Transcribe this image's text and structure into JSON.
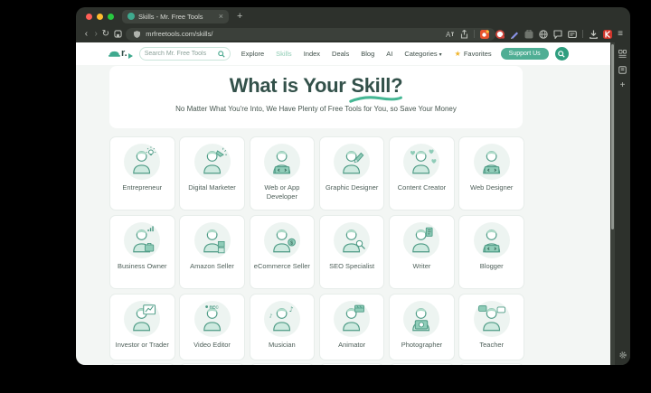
{
  "browser": {
    "tab_title": "Skills - Mr. Free Tools",
    "tab_close_glyph": "×",
    "new_tab_glyph": "+",
    "url": "mrfreetools.com/skills/",
    "traffic_lights": [
      {
        "name": "close-window-button",
        "color": "#ff5f57"
      },
      {
        "name": "minimize-window-button",
        "color": "#febc2e"
      },
      {
        "name": "zoom-window-button",
        "color": "#28c840"
      }
    ],
    "toolbar_icons": [
      "back-icon",
      "forward-icon",
      "reload-icon",
      "bookmark-icon",
      "shield-icon"
    ],
    "url_action_icons": [
      "translate-icon",
      "share-icon",
      "extension-main-icon"
    ],
    "pinned_extensions": [
      {
        "name": "extension-red-circle-icon",
        "style": "red-circle"
      },
      {
        "name": "extension-pen-icon",
        "style": "pen"
      },
      {
        "name": "extension-dark-square-icon",
        "style": "dark-square"
      },
      {
        "name": "extension-globe-icon",
        "style": "globe"
      },
      {
        "name": "extension-chat-icon",
        "style": "chat"
      },
      {
        "name": "extension-card-icon",
        "style": "card"
      }
    ],
    "right_icons": [
      "download-icon",
      "red-k-extension-icon",
      "menu-icon"
    ],
    "sidebar_icons": [
      "tab-groups-icon",
      "panel-icon",
      "add-tab-icon",
      "settings-gear-icon"
    ]
  },
  "navbar": {
    "logo_text": "r.",
    "search_placeholder": "Search Mr. Free Tools",
    "links": [
      {
        "label": "Explore",
        "active": false
      },
      {
        "label": "Skills",
        "active": true
      },
      {
        "label": "Index",
        "active": false
      },
      {
        "label": "Deals",
        "active": false
      },
      {
        "label": "Blog",
        "active": false
      },
      {
        "label": "AI",
        "active": false
      },
      {
        "label": "Categories",
        "active": false,
        "has_dropdown": true
      }
    ],
    "favorites_label": "Favorites",
    "support_label": "Support Us"
  },
  "hero": {
    "title_prefix": "What is Your ",
    "title_highlight": "Skill?",
    "subtitle": "No Matter What You're Into, We Have Plenty of Free Tools for You, so Save Your Money"
  },
  "skills": [
    {
      "label": "Entrepreneur",
      "icon": "entrepreneur-icon",
      "accessory": "bulb"
    },
    {
      "label": "Digital Marketer",
      "icon": "digital-marketer-icon",
      "accessory": "megaphone"
    },
    {
      "label": "Web or App Developer",
      "icon": "web-or-app-developer-icon",
      "accessory": "laptop"
    },
    {
      "label": "Graphic Designer",
      "icon": "graphic-designer-icon",
      "accessory": "pen"
    },
    {
      "label": "Content Creator",
      "icon": "content-creator-icon",
      "accessory": "hearts"
    },
    {
      "label": "Web Designer",
      "icon": "web-designer-icon",
      "accessory": "laptop"
    },
    {
      "label": "Business Owner",
      "icon": "business-owner-icon",
      "accessory": "briefcase"
    },
    {
      "label": "Amazon Seller",
      "icon": "amazon-seller-icon",
      "accessory": "boxes"
    },
    {
      "label": "eCommerce Seller",
      "icon": "ecommerce-seller-icon",
      "accessory": "coin"
    },
    {
      "label": "SEO Specialist",
      "icon": "seo-specialist-icon",
      "accessory": "magnifier"
    },
    {
      "label": "Writer",
      "icon": "writer-icon",
      "accessory": "book"
    },
    {
      "label": "Blogger",
      "icon": "blogger-icon",
      "accessory": "laptop"
    },
    {
      "label": "Investor or Trader",
      "icon": "investor-or-trader-icon",
      "accessory": "chart-frame"
    },
    {
      "label": "Video Editor",
      "icon": "video-editor-icon",
      "accessory": "rec"
    },
    {
      "label": "Musician",
      "icon": "musician-icon",
      "accessory": "music"
    },
    {
      "label": "Animator",
      "icon": "animator-icon",
      "accessory": "clapper"
    },
    {
      "label": "Photographer",
      "icon": "photographer-icon",
      "accessory": "camera"
    },
    {
      "label": "Teacher",
      "icon": "teacher-icon",
      "accessory": "bubbles"
    }
  ],
  "colors": {
    "accent": "#46a68c",
    "accent_dark": "#33514a",
    "chrome_bg": "#2d312c",
    "page_bg": "#f3f6f4",
    "star": "#f0b429",
    "underline": "#45b794"
  }
}
